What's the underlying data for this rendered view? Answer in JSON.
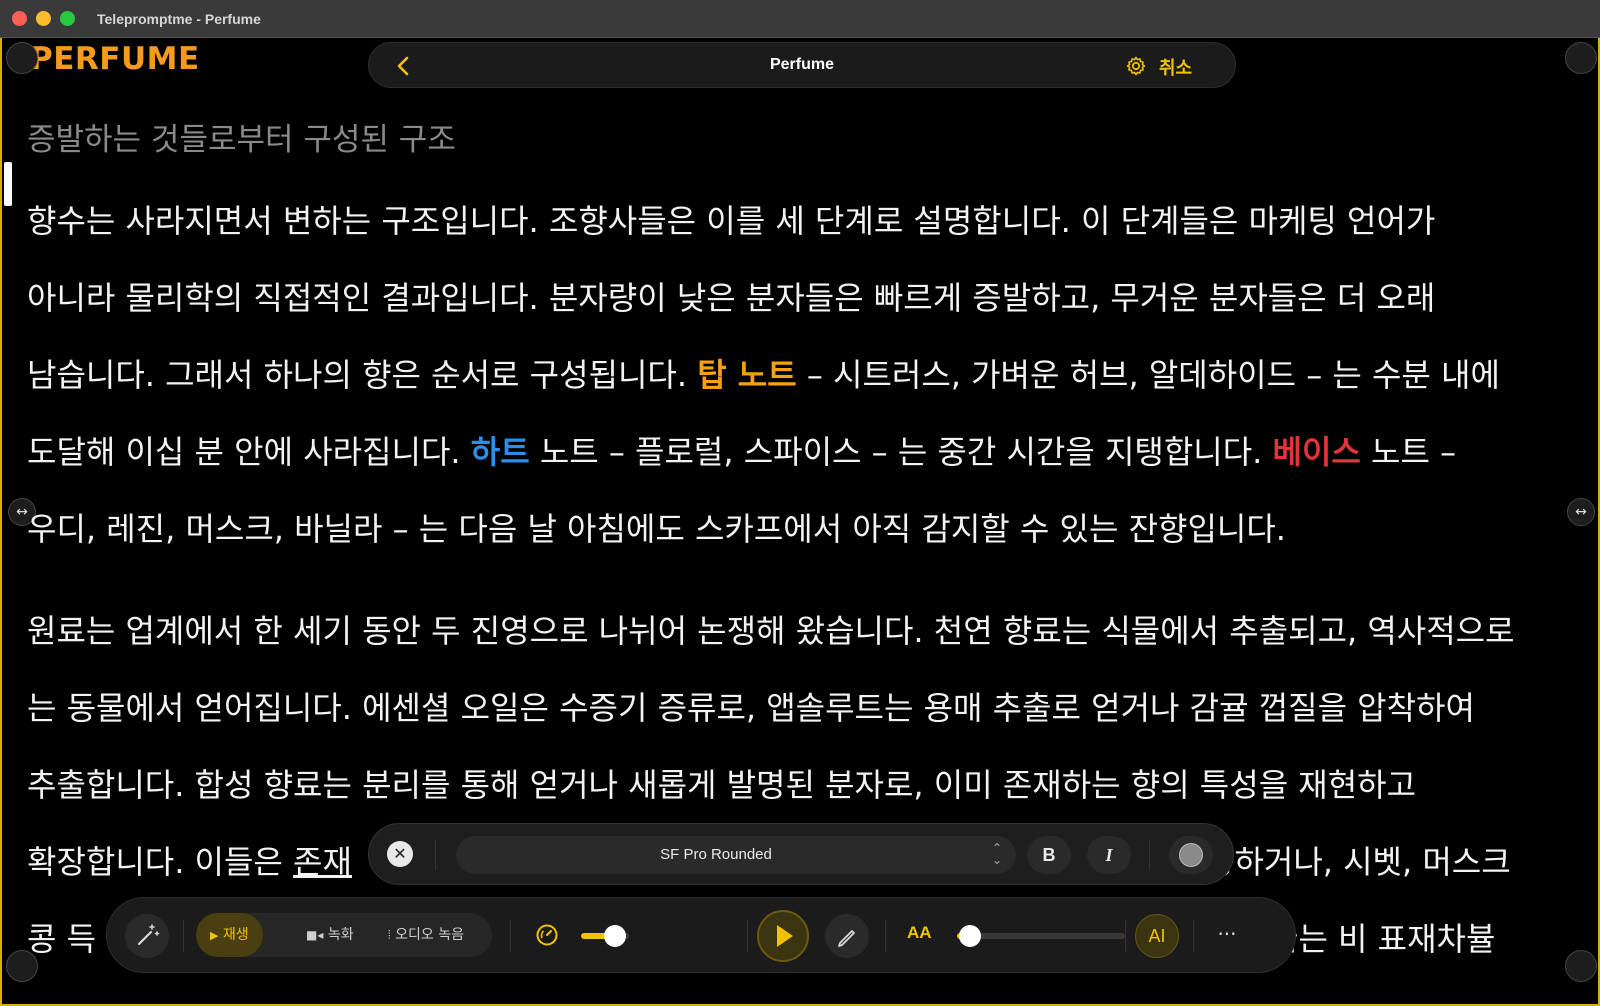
{
  "window": {
    "title": "Telepromptme - Perfume"
  },
  "logo": {
    "text": "PERFUME"
  },
  "nav": {
    "title": "Perfume",
    "cancel_label": "취소"
  },
  "script": {
    "subtitle": "증발하는 것들로부터 구성된 구조",
    "p1": {
      "l1": "향수는 사라지면서 변하는 구조입니다. 조향사들은 이를 세 단계로 설명합니다. 이 단계들은 마케팅 언어가",
      "l2": "아니라 물리학의 직접적인 결과입니다. 분자량이 낮은 분자들은 빠르게 증발하고, 무거운 분자들은 더 오래",
      "l3a": "남습니다. 그래서 하나의 향은 순서로 구성됩니다. ",
      "l3_top": "탑 노트",
      "l3b": " – 시트러스, 가벼운 허브, 알데하이드 – 는 수분 내에",
      "l4a": "도달해 이십 분 안에 사라집니다. ",
      "l4_heart": "하트",
      "l4b": " 노트 – 플로럴, 스파이스 – 는 중간 시간을 지탱합니다. ",
      "l4_base": "베이스",
      "l4c": " 노트 –",
      "l5": "우디, 레진, 머스크, 바닐라 – 는 다음 날 아침에도 스카프에서 아직 감지할 수 있는 잔향입니다."
    },
    "p2": {
      "l1": "원료는 업계에서 한 세기 동안 두 진영으로 나뉘어 논쟁해 왔습니다. 천연 향료는 식물에서 추출되고, 역사적으로",
      "l2": "는 동물에서 얻어집니다. 에센셜 오일은 수증기 증류로, 앱솔루트는 용매 추출로 얻거나 감귤 껍질을 압착하여",
      "l3": "추출합니다. 합성 향료는 분리를 통해 얻거나 새롭게 발명된 분자로, 이미 존재하는 향의 특성을 재현하고",
      "l4a": "확장합니다. 이들은 ",
      "l4_underline": "존재",
      "l4b": "방하거나, 시벳, 머스크",
      "l5a": "콩 득",
      "l5b": "굶는 비 표재차뷸"
    }
  },
  "font_toolbar": {
    "font_name": "SF Pro Rounded",
    "bold_label": "B",
    "italic_label": "I"
  },
  "control_bar": {
    "modes": [
      {
        "label": "재생",
        "icon": "play-icon",
        "active": true
      },
      {
        "label": "녹화",
        "icon": "video-camera-icon",
        "active": false
      },
      {
        "label": "오디오 녹음",
        "icon": "waveform-icon",
        "active": false
      }
    ],
    "speed_slider_value": 0.7,
    "text_size_label": "AA",
    "text_size_slider_value": 0.08,
    "accent_color": "#f2c200"
  },
  "colors": {
    "accent": "#f2c200",
    "logo": "#f59a1c",
    "top_note": "#f5a20f",
    "heart_note": "#2d8ee8",
    "base_note": "#e0353b"
  }
}
